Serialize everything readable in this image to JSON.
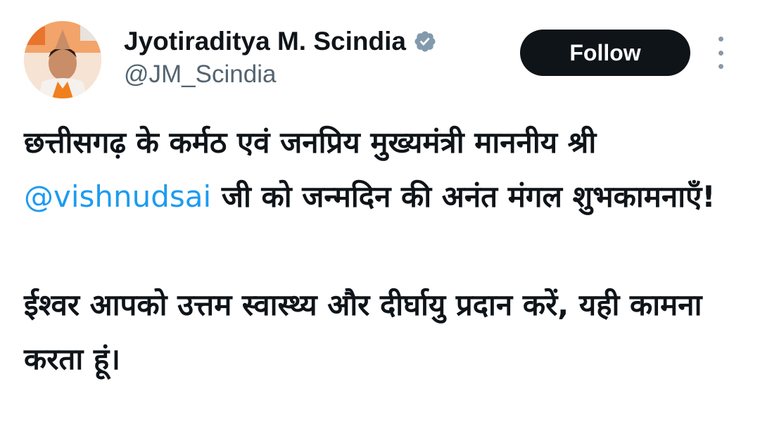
{
  "author": {
    "display_name": "Jyotiraditya M. Scindia",
    "handle": "@JM_Scindia",
    "verified": true,
    "verified_icon": "verified-badge-icon"
  },
  "actions": {
    "follow_label": "Follow",
    "more_icon": "more-vertical-icon"
  },
  "tweet": {
    "paragraph1_part1": "छत्तीसगढ़ के कर्मठ एवं जनप्रिय मुख्यमंत्री माननीय श्री ",
    "mention": "@vishnudsai",
    "paragraph1_part2": " जी को जन्मदिन की अनंत मंगल शुभकामनाएँ!",
    "paragraph2": "ईश्वर आपको उत्तम स्वास्थ्य और दीर्घायु प्रदान करें, यही कामना करता हूं।"
  },
  "colors": {
    "text": "#0f1419",
    "secondary_text": "#536471",
    "link": "#1d9bf0",
    "follow_button_bg": "#0f1419",
    "follow_button_text": "#ffffff",
    "badge_gray": "#829aab"
  }
}
